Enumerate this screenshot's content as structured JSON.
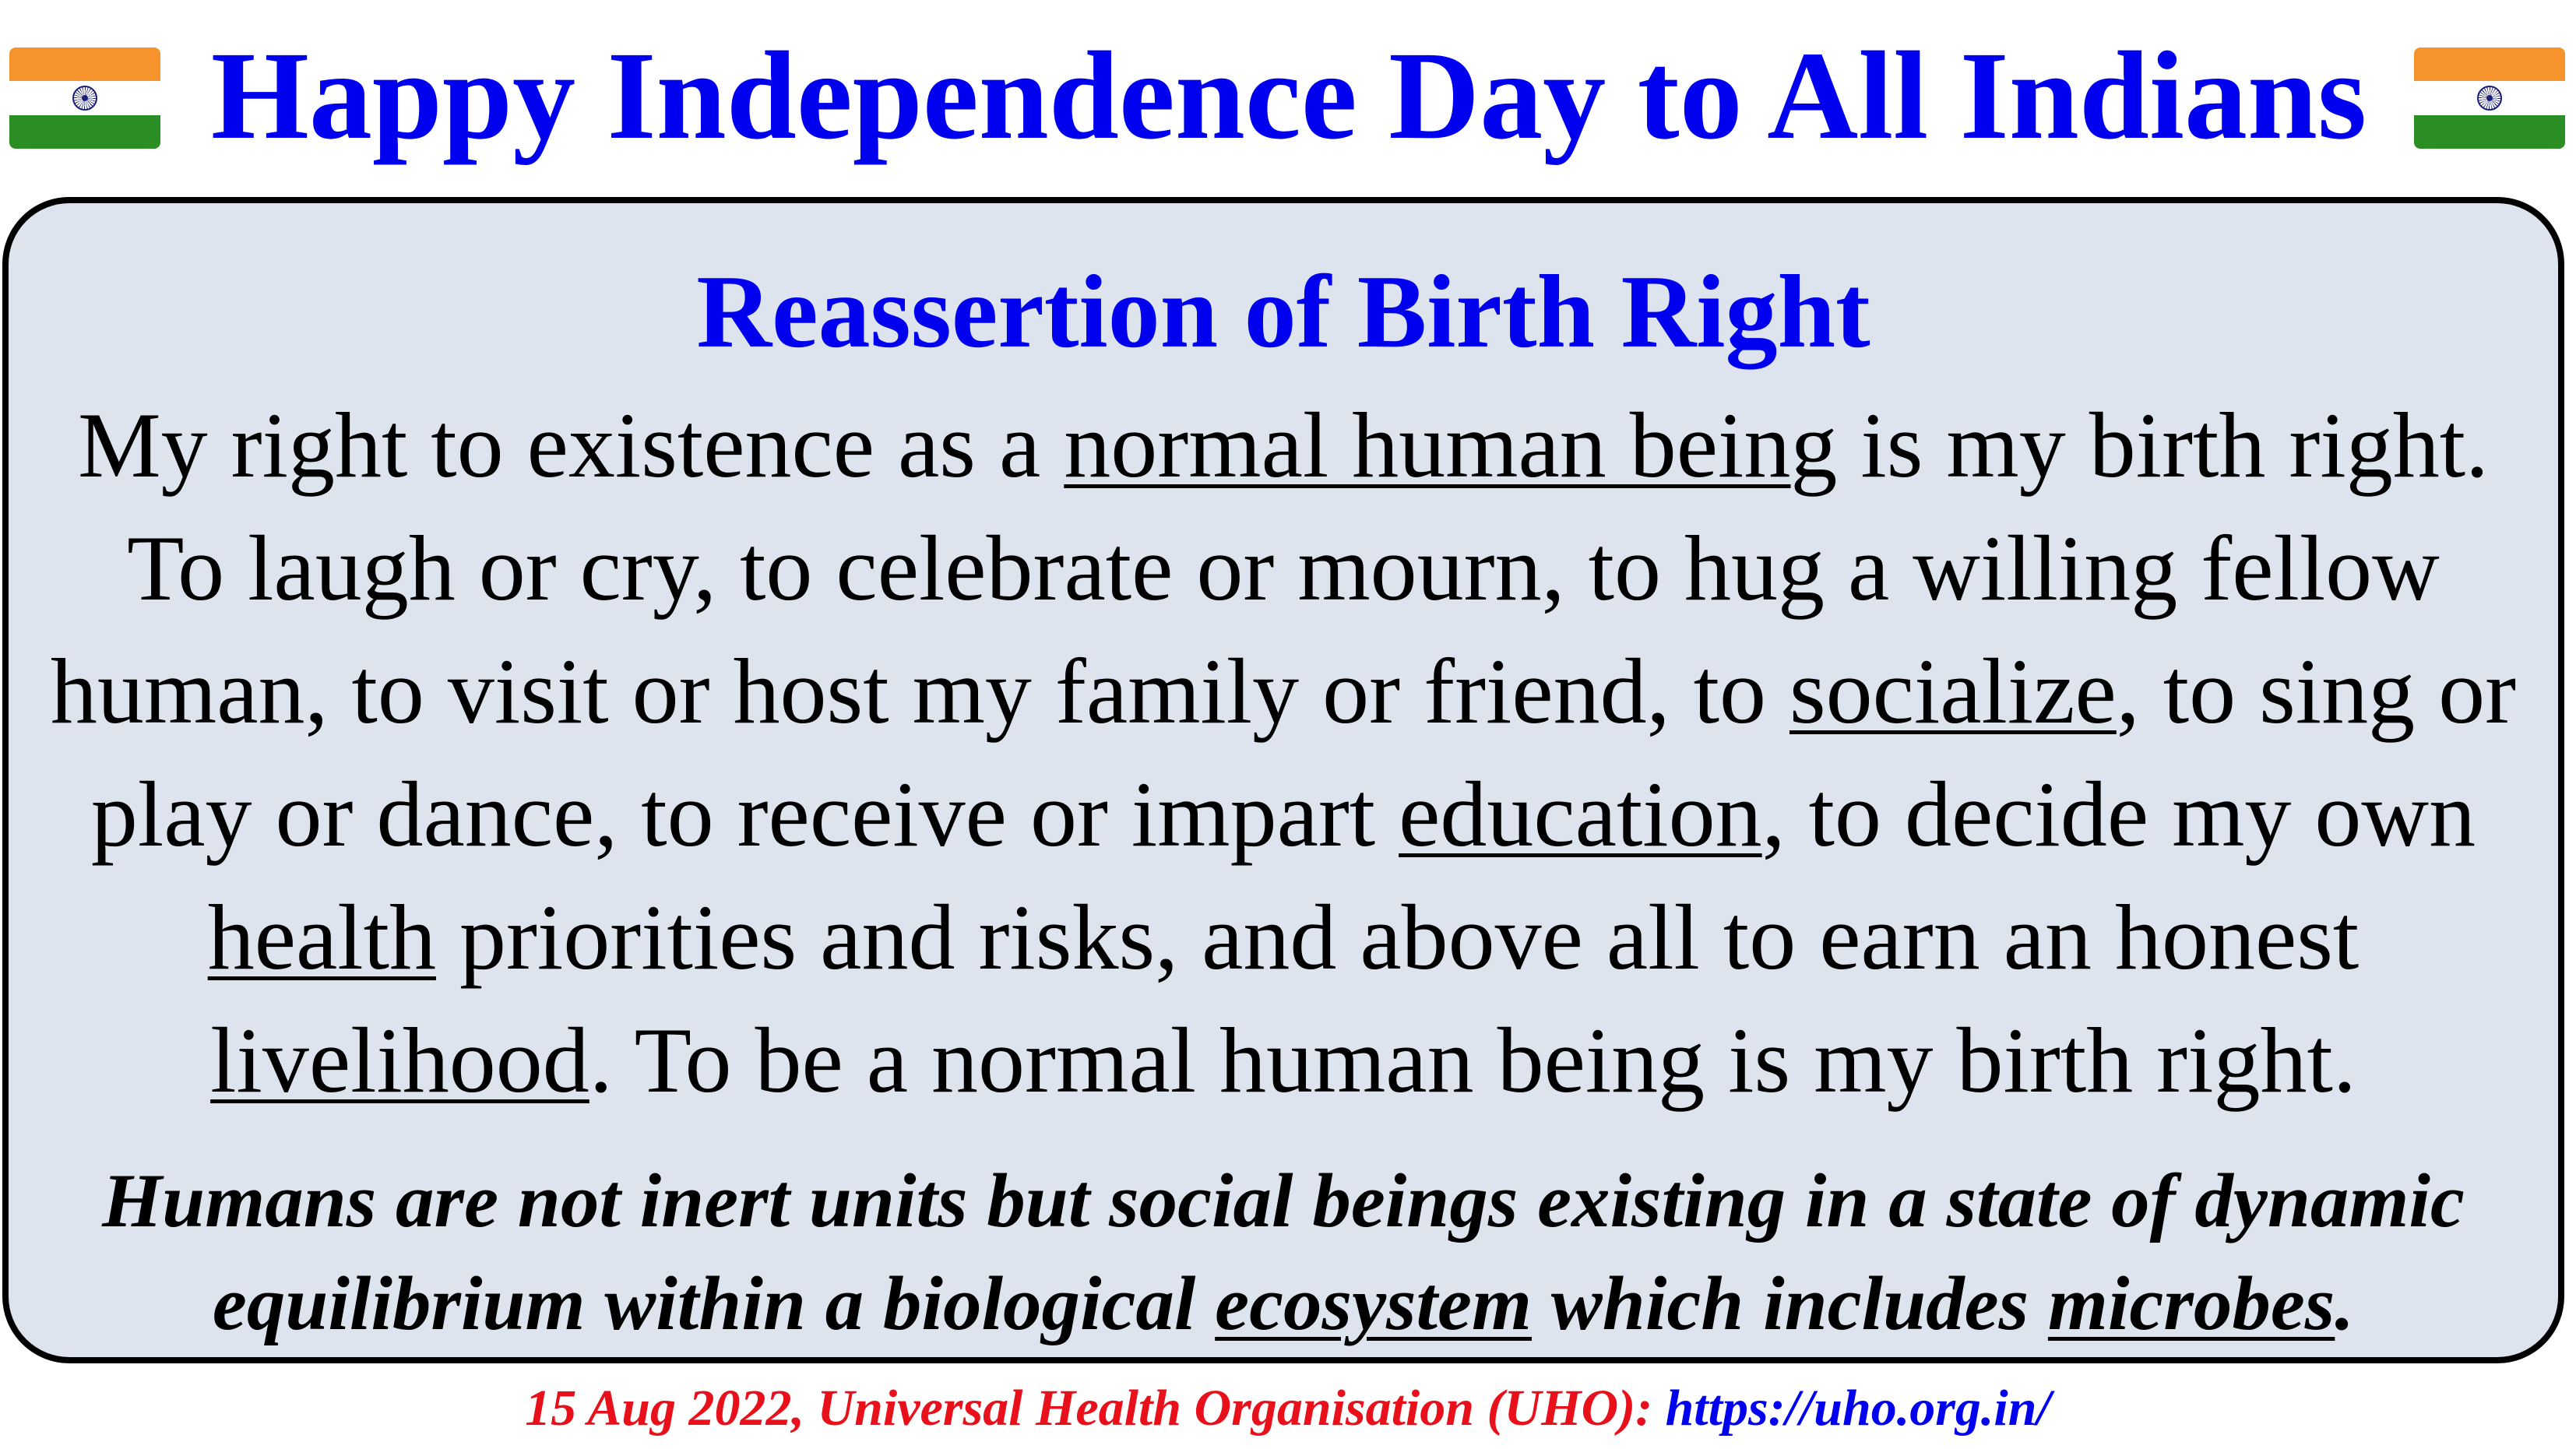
{
  "header": {
    "title": "Happy Independence Day to All Indians",
    "title_color": "#0000ee",
    "flag_icon": "indian-flag-icon",
    "flag_colors": {
      "saffron": "#f7932d",
      "white": "#ffffff",
      "green": "#2a8e25",
      "chakra": "#1a1f7a"
    }
  },
  "content": {
    "heading": "Reassertion of Birth Right",
    "body_segments": [
      "My right to existence as a ",
      "normal human being",
      " is my birth right. To laugh or cry, to celebrate or mourn, to hug a willing fellow human, to visit or host my family or friend, to ",
      "socialize",
      ", to sing or play or dance, to receive or impart ",
      "education",
      ", to decide my own ",
      "health",
      " priorities and risks, and above all to earn an honest ",
      "livelihood",
      ". To be a normal human being is my birth right."
    ],
    "closing_segments": [
      "Humans are not inert units but social beings existing in a state of dynamic equilibrium within a biological ",
      "ecosystem",
      " which includes ",
      "microbes",
      "."
    ],
    "box_background": "#dde4ee"
  },
  "footer": {
    "credit": "15 Aug 2022, Universal Health Organisation (UHO): ",
    "url": "https://uho.org.in/",
    "credit_color": "#e8101a",
    "url_color": "#0000ee"
  }
}
